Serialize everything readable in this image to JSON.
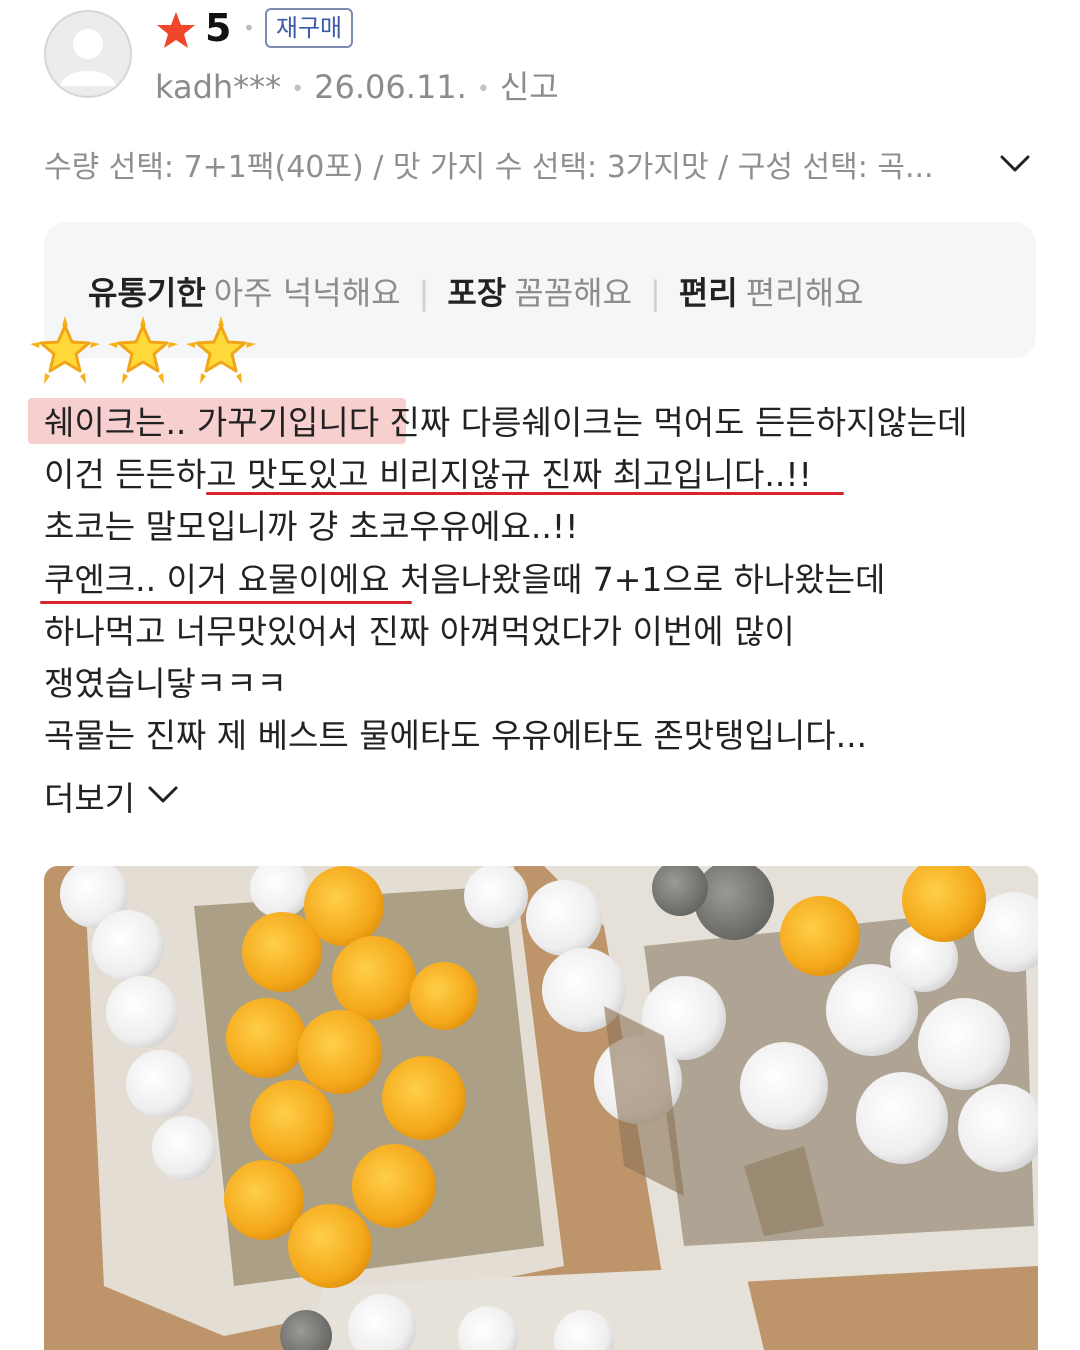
{
  "review": {
    "rating": "5",
    "badge": "재구매",
    "user": "kadh***",
    "date": "26.06.11.",
    "report": "신고",
    "options": "수량 선택: 7+1팩(40포) / 맛 가지 수 선택: 3가지맛 / 구성 선택: 곡...",
    "summary": [
      {
        "key": "유통기한",
        "value": "아주 넉넉해요"
      },
      {
        "key": "포장",
        "value": "꼼꼼해요"
      },
      {
        "key": "편리",
        "value": "편리해요"
      }
    ],
    "body_lines": [
      "쉐이크는.. 가꾸기입니다 진짜 다릉쉐이크는 먹어도 든든하지않는데",
      "이건 든든하고 맛도있고 비리지않규 진짜 최고입니다..!!",
      "초코는 말모입니까 걍 초코우유에요..!!",
      "쿠엔크.. 이거 요물이에요 처음나왔을때 7+1으로 하나왔는데",
      "하나먹고 너무맛있어서 진짜 아껴먹었다가 이번에 많이",
      "쟁였습니닿ㅋㅋㅋ",
      "곡물는 진짜 제 베스트 물에타도 우유에타도 존맛탱입니다..."
    ],
    "more_label": "더보기"
  },
  "colors": {
    "star": "#f0462a",
    "badge_text": "#3b5aa8",
    "highlight": "#f8cfcf",
    "underline": "#d9232a"
  },
  "icons": {
    "avatar": "default-user-avatar",
    "rating_star": "star-icon",
    "options_expand": "chevron-down-icon",
    "more_expand": "chevron-down-icon",
    "stickers": "glowing-star-emoji"
  }
}
